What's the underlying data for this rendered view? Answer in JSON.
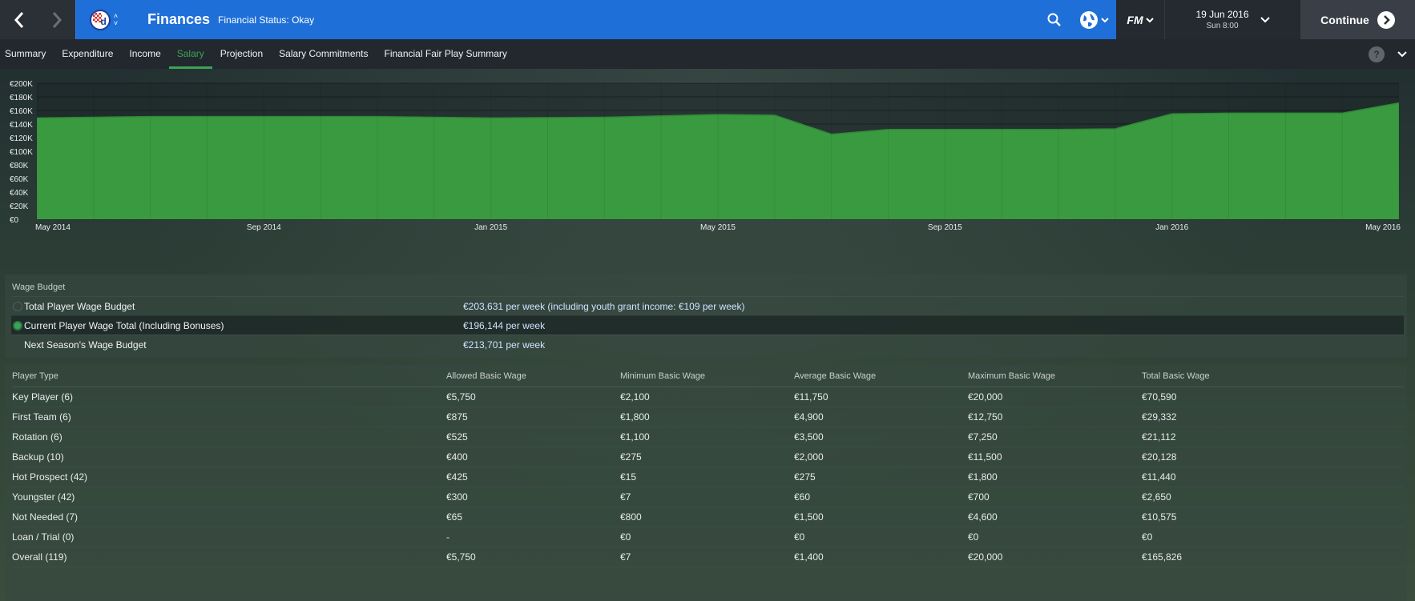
{
  "header": {
    "title": "Finances",
    "status": "Financial Status: Okay",
    "date": "19 Jun 2016",
    "time": "Sun 8:00",
    "fm_label": "FM",
    "continue_label": "Continue",
    "club_letter": "d"
  },
  "tabs": [
    {
      "label": "Summary"
    },
    {
      "label": "Expenditure"
    },
    {
      "label": "Income"
    },
    {
      "label": "Salary"
    },
    {
      "label": "Projection"
    },
    {
      "label": "Salary Commitments"
    },
    {
      "label": "Financial Fair Play Summary"
    }
  ],
  "help_label": "?",
  "colors": {
    "accent": "#3ca35a",
    "header": "#1e6fd8",
    "area": "#3a9a3f"
  },
  "chart_data": {
    "type": "area",
    "title": "",
    "xlabel": "",
    "ylabel": "",
    "ylim": [
      0,
      200000
    ],
    "y_ticks": [
      "€0",
      "€20K",
      "€40K",
      "€60K",
      "€80K",
      "€100K",
      "€120K",
      "€140K",
      "€160K",
      "€180K",
      "€200K"
    ],
    "x_ticks": [
      "May 2014",
      "Sep 2014",
      "Jan 2015",
      "May 2015",
      "Sep 2015",
      "Jan 2016",
      "May 2016"
    ],
    "x_tick_months": [
      0,
      4,
      8,
      12,
      16,
      20,
      24
    ],
    "series": [
      {
        "x_months": [
          0,
          2,
          4,
          6,
          8,
          10,
          12,
          13,
          14,
          15,
          16,
          17,
          18,
          19,
          20,
          21,
          22,
          23,
          24
        ],
        "values": [
          149000,
          151000,
          151000,
          151000,
          149000,
          150000,
          154000,
          153000,
          125000,
          132000,
          132000,
          132000,
          132000,
          133000,
          155000,
          156000,
          156000,
          156000,
          171000
        ]
      }
    ],
    "grid": true
  },
  "wage_budget": {
    "title": "Wage Budget",
    "rows": [
      {
        "label": "Total Player Wage Budget",
        "value": "€203,631 per week (including youth grant income: €109 per week)"
      },
      {
        "label": "Current Player Wage Total (Including Bonuses)",
        "value": "€196,144 per week"
      },
      {
        "label": "Next Season's Wage Budget",
        "value": "€213,701 per week"
      }
    ]
  },
  "player_types": {
    "headers": [
      "Player Type",
      "Allowed Basic Wage",
      "Minimum Basic Wage",
      "Average Basic Wage",
      "Maximum Basic Wage",
      "Total Basic Wage"
    ],
    "rows": [
      [
        "Key Player (6)",
        "€5,750",
        "€2,100",
        "€11,750",
        "€20,000",
        "€70,590"
      ],
      [
        "First Team (6)",
        "€875",
        "€1,800",
        "€4,900",
        "€12,750",
        "€29,332"
      ],
      [
        "Rotation (6)",
        "€525",
        "€1,100",
        "€3,500",
        "€7,250",
        "€21,112"
      ],
      [
        "Backup (10)",
        "€400",
        "€275",
        "€2,000",
        "€11,500",
        "€20,128"
      ],
      [
        "Hot Prospect (42)",
        "€425",
        "€15",
        "€275",
        "€1,800",
        "€11,440"
      ],
      [
        "Youngster (42)",
        "€300",
        "€7",
        "€60",
        "€700",
        "€2,650"
      ],
      [
        "Not Needed (7)",
        "€65",
        "€800",
        "€1,500",
        "€4,600",
        "€10,575"
      ],
      [
        "Loan / Trial (0)",
        "-",
        "€0",
        "€0",
        "€0",
        "€0"
      ],
      [
        "Overall (119)",
        "€5,750",
        "€7",
        "€1,400",
        "€20,000",
        "€165,826"
      ]
    ]
  }
}
